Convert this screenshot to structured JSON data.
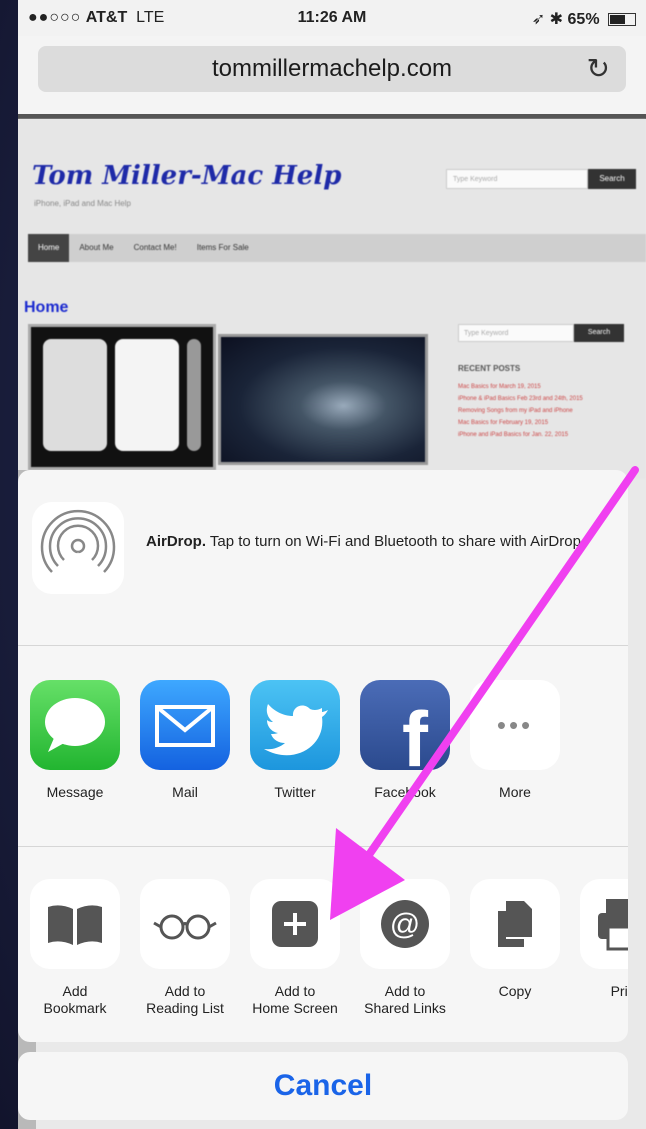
{
  "status": {
    "carrier": "AT&T",
    "network": "LTE",
    "time": "11:26 AM",
    "battery": "65%"
  },
  "browser": {
    "url": "tommillermachelp.com"
  },
  "website": {
    "title": "Tom Miller-Mac Help",
    "subtitle": "iPhone, iPad and Mac Help",
    "search_placeholder": "Type Keyword",
    "search_button": "Search",
    "nav": [
      "Home",
      "About Me",
      "Contact Me!",
      "Items For Sale"
    ],
    "page_heading": "Home",
    "sidebar_search_placeholder": "Type Keyword",
    "sidebar_search_button": "Search",
    "recent_posts_heading": "RECENT POSTS",
    "recent_posts": [
      "Mac Basics for March 19, 2015",
      "iPhone & iPad Basics Feb 23rd and 24th, 2015",
      "Removing Songs from my iPad and iPhone",
      "Mac Basics for February 19, 2015",
      "iPhone and iPad Basics for Jan. 22, 2015"
    ]
  },
  "share_sheet": {
    "airdrop_title": "AirDrop.",
    "airdrop_text": "Tap to turn on Wi-Fi and Bluetooth to share with AirDrop.",
    "apps": [
      {
        "label": "Message",
        "icon": "message-icon",
        "color": "#34c84a"
      },
      {
        "label": "Mail",
        "icon": "mail-icon",
        "color": "#1e7cf2"
      },
      {
        "label": "Twitter",
        "icon": "twitter-icon",
        "color": "#29a9eb"
      },
      {
        "label": "Facebook",
        "icon": "facebook-icon",
        "color": "#3b5998"
      },
      {
        "label": "More",
        "icon": "more-icon",
        "color": "#ffffff"
      }
    ],
    "actions": [
      {
        "line1": "Add",
        "line2": "Bookmark",
        "icon": "bookmark-icon"
      },
      {
        "line1": "Add to",
        "line2": "Reading List",
        "icon": "reading-list-icon"
      },
      {
        "line1": "Add to",
        "line2": "Home Screen",
        "icon": "add-home-screen-icon"
      },
      {
        "line1": "Add to",
        "line2": "Shared Links",
        "icon": "shared-links-icon"
      },
      {
        "line1": "Copy",
        "line2": "",
        "icon": "copy-icon"
      },
      {
        "line1": "Print",
        "line2": "",
        "icon": "print-icon"
      }
    ],
    "cancel": "Cancel"
  },
  "annotation": {
    "arrow_color": "#f040f0"
  }
}
